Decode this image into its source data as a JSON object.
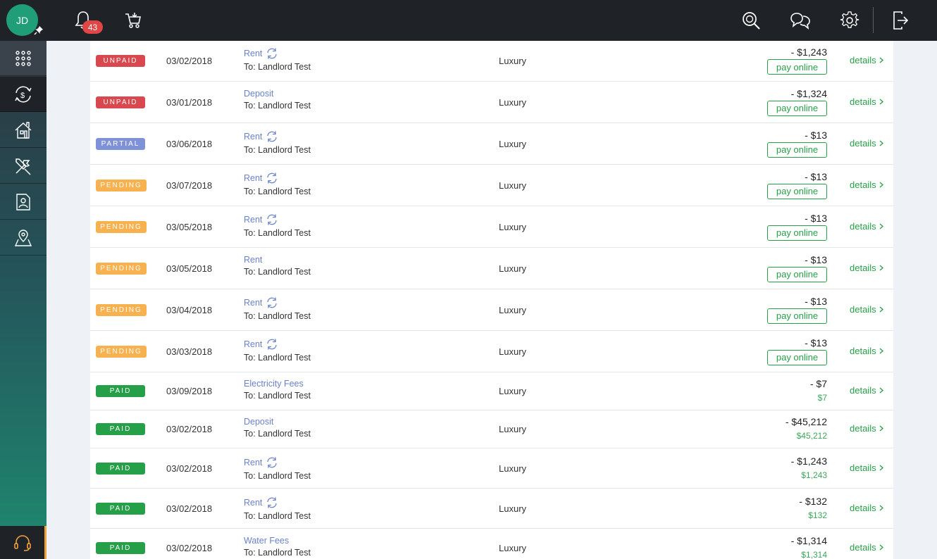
{
  "user": {
    "initials": "JD"
  },
  "notifications": {
    "count": "43"
  },
  "icons": {
    "bell": "bell-icon",
    "cart": "cart-icon",
    "search": "search-icon",
    "chat": "chat-icon",
    "gear": "gear-icon",
    "logout": "logout-icon"
  },
  "colors": {
    "unpaid": "#d9484f",
    "partial": "#7f92d8",
    "pending": "#f7b14e",
    "paid": "#26a048",
    "link": "#6a82c7",
    "accent": "#f0a23a"
  },
  "sidebar": {
    "items": [
      {
        "name": "apps-grid-icon"
      },
      {
        "name": "payments-icon"
      },
      {
        "name": "properties-icon"
      },
      {
        "name": "maintenance-icon"
      },
      {
        "name": "documents-icon"
      },
      {
        "name": "location-icon"
      }
    ],
    "support": "headset-icon"
  },
  "rows": [
    {
      "status": "UNPAID",
      "date": "03/02/2018",
      "title": "Rent",
      "recurring": true,
      "to": "To: Landlord Test",
      "property": "Luxury",
      "amount": "- $1,243",
      "action": "pay online",
      "details": "details"
    },
    {
      "status": "UNPAID",
      "date": "03/01/2018",
      "title": "Deposit",
      "recurring": false,
      "to": "To: Landlord Test",
      "property": "Luxury",
      "amount": "- $1,324",
      "action": "pay online",
      "details": "details"
    },
    {
      "status": "PARTIAL",
      "date": "03/06/2018",
      "title": "Rent",
      "recurring": true,
      "to": "To: Landlord Test",
      "property": "Luxury",
      "amount": "- $13",
      "action": "pay online",
      "details": "details"
    },
    {
      "status": "PENDING",
      "date": "03/07/2018",
      "title": "Rent",
      "recurring": true,
      "to": "To: Landlord Test",
      "property": "Luxury",
      "amount": "- $13",
      "action": "pay online",
      "details": "details"
    },
    {
      "status": "PENDING",
      "date": "03/05/2018",
      "title": "Rent",
      "recurring": true,
      "to": "To: Landlord Test",
      "property": "Luxury",
      "amount": "- $13",
      "action": "pay online",
      "details": "details"
    },
    {
      "status": "PENDING",
      "date": "03/05/2018",
      "title": "Rent",
      "recurring": false,
      "to": "To: Landlord Test",
      "property": "Luxury",
      "amount": "- $13",
      "action": "pay online",
      "details": "details"
    },
    {
      "status": "PENDING",
      "date": "03/04/2018",
      "title": "Rent",
      "recurring": true,
      "to": "To: Landlord Test",
      "property": "Luxury",
      "amount": "- $13",
      "action": "pay online",
      "details": "details"
    },
    {
      "status": "PENDING",
      "date": "03/03/2018",
      "title": "Rent",
      "recurring": true,
      "to": "To: Landlord Test",
      "property": "Luxury",
      "amount": "- $13",
      "action": "pay online",
      "details": "details"
    },
    {
      "status": "PAID",
      "date": "03/09/2018",
      "title": "Electricity Fees",
      "recurring": false,
      "to": "To: Landlord Test",
      "property": "Luxury",
      "amount": "- $7",
      "paid": "$7",
      "details": "details"
    },
    {
      "status": "PAID",
      "date": "03/02/2018",
      "title": "Deposit",
      "recurring": false,
      "to": "To: Landlord Test",
      "property": "Luxury",
      "amount": "- $45,212",
      "paid": "$45,212",
      "details": "details"
    },
    {
      "status": "PAID",
      "date": "03/02/2018",
      "title": "Rent",
      "recurring": true,
      "to": "To: Landlord Test",
      "property": "Luxury",
      "amount": "- $1,243",
      "paid": "$1,243",
      "details": "details"
    },
    {
      "status": "PAID",
      "date": "03/02/2018",
      "title": "Rent",
      "recurring": true,
      "to": "To: Landlord Test",
      "property": "Luxury",
      "amount": "- $132",
      "paid": "$132",
      "details": "details"
    },
    {
      "status": "PAID",
      "date": "03/02/2018",
      "title": "Water Fees",
      "recurring": false,
      "to": "To: Landlord Test",
      "property": "Luxury",
      "amount": "- $1,314",
      "paid": "$1,314",
      "details": "details"
    }
  ]
}
